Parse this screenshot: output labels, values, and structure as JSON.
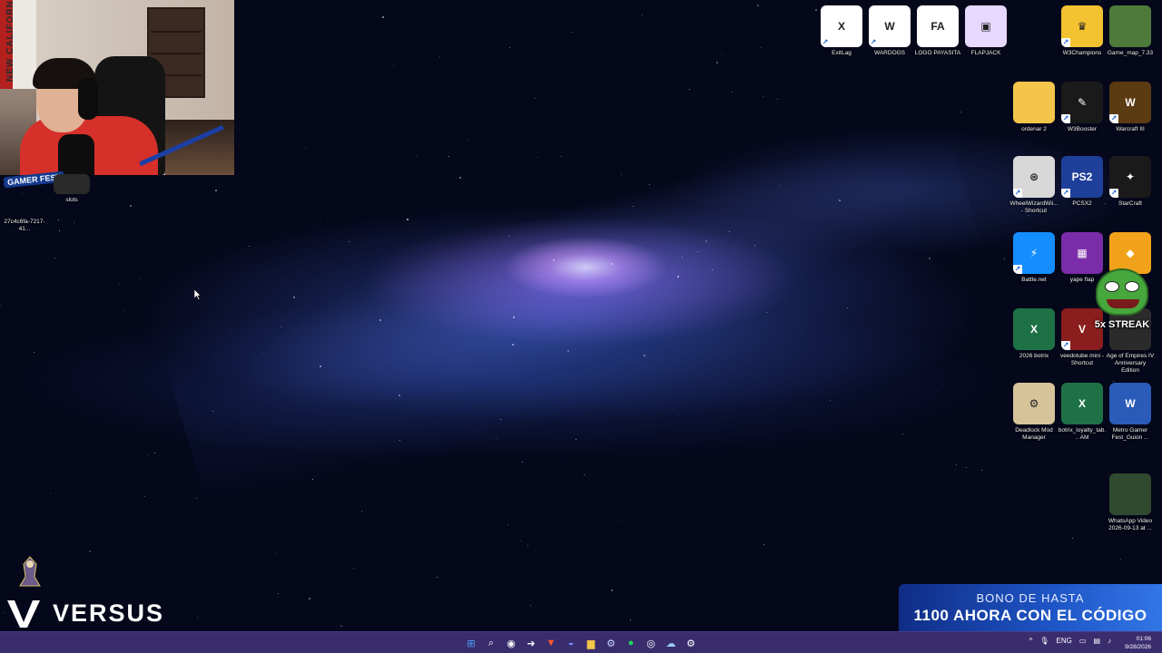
{
  "webcam": {
    "banner_text": "NEW CALIFORN"
  },
  "overlay_text": {
    "gamer_fest": "GAMER FEST",
    "streak": "5x STREAK",
    "versus": "VERSUS",
    "bono_line1": "BONO DE HASTA",
    "bono_line2": "1100 AHORA CON EL CÓDIGO"
  },
  "desktop_icons_left": [
    {
      "label": "27c4c6fa-7217-41...",
      "icon": "file-icon",
      "color": "#2b2f45"
    },
    {
      "label": "slots",
      "icon": "folder-dark-icon",
      "color": "#3a3a3a"
    }
  ],
  "desktop_icons_right": [
    {
      "label": "ExitLag",
      "icon": "exitlag-icon",
      "color": "#ffffff",
      "text": "X"
    },
    {
      "label": "WARDOGS",
      "icon": "wardogs-icon",
      "color": "#ffffff",
      "text": "W"
    },
    {
      "label": "LOGO PAYASITA",
      "icon": "logo-payasita-icon",
      "color": "#ffffff",
      "text": "FA"
    },
    {
      "label": "FLAPJACK",
      "icon": "flapjack-icon",
      "color": "#e7d8ff",
      "text": "▣"
    },
    {
      "label": "W3Champions",
      "icon": "crown-icon",
      "color": "#f2c230",
      "text": "♛"
    },
    {
      "label": "Game_map_7.33",
      "icon": "map-icon",
      "color": "#4d7a3a",
      "text": ""
    },
    {
      "label": "ordenar 2",
      "icon": "folder-icon",
      "color": "#f3c54a",
      "text": ""
    },
    {
      "label": "W3Booster",
      "icon": "w3booster-icon",
      "color": "#1a1a1a",
      "text": "✎"
    },
    {
      "label": "Warcraft III",
      "icon": "warcraft-icon",
      "color": "#5b3b12",
      "text": "W"
    },
    {
      "label": "WheelWizardWii... - Shortcut",
      "icon": "wheel-icon",
      "color": "#d8d8d8",
      "text": "⊛"
    },
    {
      "label": "PCSX2",
      "icon": "pcsx2-icon",
      "color": "#1e3f9a",
      "text": "PS2"
    },
    {
      "label": "StarCraft",
      "icon": "starcraft-icon",
      "color": "#1a1a1a",
      "text": "✦"
    },
    {
      "label": "Battle.net",
      "icon": "battlenet-icon",
      "color": "#148eff",
      "text": "⚡"
    },
    {
      "label": "yape flap",
      "icon": "qr-code-icon",
      "color": "#7b2ca8",
      "text": "▦"
    },
    {
      "label": "",
      "icon": "duck-icon",
      "color": "#f1a21a",
      "text": "◆"
    },
    {
      "label": "2026 botrix",
      "icon": "excel-icon",
      "color": "#1e7145",
      "text": "X"
    },
    {
      "label": "veedotube mini - Shortcut",
      "icon": "veedotube-icon",
      "color": "#8a1d1d",
      "text": "V"
    },
    {
      "label": "Age of Empires IV Anniversary Edition",
      "icon": "aoe-icon",
      "color": "#2b2b2b",
      "text": ""
    },
    {
      "label": "Deadlock Mod Manager",
      "icon": "deadlock-icon",
      "color": "#d7c39a",
      "text": "⚙"
    },
    {
      "label": "botrix_loyalty_tab... AM",
      "icon": "excel-icon",
      "color": "#1e7145",
      "text": "X"
    },
    {
      "label": "Metro Gamer Fest_Guion ...",
      "icon": "word-icon",
      "color": "#2b5bb8",
      "text": "W"
    },
    {
      "label": "WhatsApp Video 2026-09-13 at ...",
      "icon": "video-thumbnail-icon",
      "color": "#2f4a2f",
      "text": ""
    }
  ],
  "taskbar": {
    "apps": [
      {
        "name": "start-button",
        "glyph": "⊞",
        "color": "#4aa3ff"
      },
      {
        "name": "search-button",
        "glyph": "⌕",
        "color": "#ffffff"
      },
      {
        "name": "taskbar-app-obs",
        "glyph": "◉",
        "color": "#ffffff"
      },
      {
        "name": "taskbar-app-media",
        "glyph": "➜",
        "color": "#ffffff"
      },
      {
        "name": "taskbar-app-brave",
        "glyph": "▼",
        "color": "#ff5a2b"
      },
      {
        "name": "taskbar-app-discord",
        "glyph": "◒",
        "color": "#7b8cff"
      },
      {
        "name": "taskbar-app-explorer",
        "glyph": "▆",
        "color": "#f3c54a"
      },
      {
        "name": "taskbar-app-steam",
        "glyph": "⚙",
        "color": "#c8d6ff"
      },
      {
        "name": "taskbar-app-spotify",
        "glyph": "●",
        "color": "#1ed760"
      },
      {
        "name": "taskbar-app-chrome",
        "glyph": "◎",
        "color": "#ffffff"
      },
      {
        "name": "taskbar-app-streamdeck",
        "glyph": "☁",
        "color": "#9ad0ff"
      },
      {
        "name": "taskbar-app-settings",
        "glyph": "⚙",
        "color": "#ffffff"
      }
    ],
    "tray": {
      "chevron": "^",
      "language": "ENG"
    },
    "time": "01:06",
    "date": "9/28/2026"
  }
}
